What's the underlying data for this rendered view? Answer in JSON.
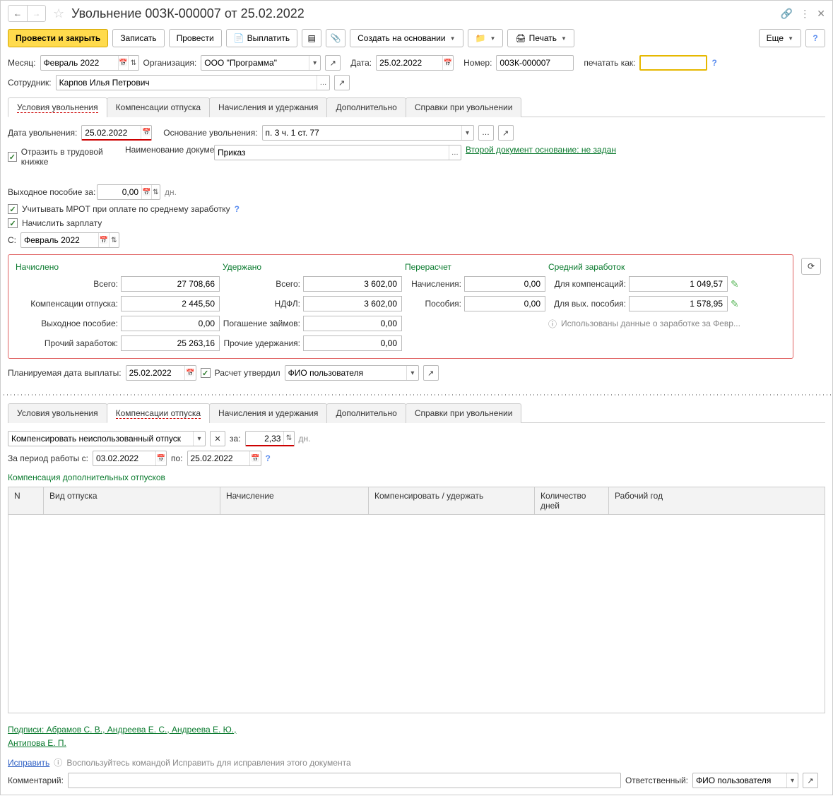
{
  "title": "Увольнение 00ЗК-000007 от 25.02.2022",
  "toolbar": {
    "post_close": "Провести и закрыть",
    "write": "Записать",
    "post": "Провести",
    "pay": "Выплатить",
    "create_based": "Создать на основании",
    "print": "Печать",
    "more": "Еще"
  },
  "header": {
    "month_label": "Месяц:",
    "month": "Февраль 2022",
    "org_label": "Организация:",
    "org": "ООО \"Программа\"",
    "date_label": "Дата:",
    "date": "25.02.2022",
    "number_label": "Номер:",
    "number": "00ЗК-000007",
    "print_as_label": "печатать как:",
    "print_as": "",
    "employee_label": "Сотрудник:",
    "employee": "Карпов Илья Петрович"
  },
  "tabs1": [
    "Условия увольнения",
    "Компенсации отпуска",
    "Начисления и удержания",
    "Дополнительно",
    "Справки при увольнении"
  ],
  "tab1": {
    "dismiss_date_label": "Дата увольнения:",
    "dismiss_date": "25.02.2022",
    "basis_label": "Основание увольнения:",
    "basis": "п. 3 ч. 1 ст. 77",
    "reflect_label": "Отразить в трудовой книжке",
    "docname_label": "Наименование документа:",
    "docname": "Приказ",
    "second_doc_link": "Второй документ основание: не задан",
    "severance_label": "Выходное пособие за:",
    "severance_val": "0,00",
    "days_suffix": "дн.",
    "mrot_label": "Учитывать МРОТ при оплате по среднему заработку",
    "accrue_salary_label": "Начислить зарплату",
    "from_label": "С:",
    "from_val": "Февраль 2022"
  },
  "summary": {
    "accrued_hdr": "Начислено",
    "withheld_hdr": "Удержано",
    "recalc_hdr": "Перерасчет",
    "avg_hdr": "Средний заработок",
    "total_label": "Всего:",
    "accrued_total": "27 708,66",
    "comp_label": "Компенсации отпуска:",
    "comp_val": "2 445,50",
    "sev_label": "Выходное пособие:",
    "sev_val": "0,00",
    "other_label": "Прочий заработок:",
    "other_val": "25 263,16",
    "withheld_total": "3 602,00",
    "ndfl_label": "НДФЛ:",
    "ndfl_val": "3 602,00",
    "loan_label": "Погашение займов:",
    "loan_val": "0,00",
    "other_withh_label": "Прочие удержания:",
    "other_withh_val": "0,00",
    "recalc_accr_label": "Начисления:",
    "recalc_accr_val": "0,00",
    "recalc_ben_label": "Пособия:",
    "recalc_ben_val": "0,00",
    "avg_comp_label": "Для компенсаций:",
    "avg_comp_val": "1 049,57",
    "avg_sev_label": "Для вых. пособия:",
    "avg_sev_val": "1 578,95",
    "info_text": "Использованы данные о заработке за Февр..."
  },
  "planned": {
    "date_label": "Планируемая дата выплаты:",
    "date_val": "25.02.2022",
    "approved_label": "Расчет утвердил",
    "approver": "ФИО пользователя"
  },
  "tabs2": [
    "Условия увольнения",
    "Компенсации отпуска",
    "Начисления и удержания",
    "Дополнительно",
    "Справки при увольнении"
  ],
  "tab2": {
    "comp_type": "Компенсировать неиспользованный отпуск",
    "for_label": "за:",
    "for_val": "2,33",
    "days_suffix": "дн.",
    "period_label": "За период работы с:",
    "period_from": "03.02.2022",
    "period_to_label": "по:",
    "period_to": "25.02.2022",
    "add_vac_label": "Компенсация дополнительных отпусков",
    "cols": {
      "n": "N",
      "type": "Вид отпуска",
      "accr": "Начисление",
      "comp": "Компенсировать / удержать",
      "days": "Количество дней",
      "year": "Рабочий год"
    }
  },
  "footer": {
    "sig_label": "Подписи: Абрамов С. В., Андреева Е. С., Андреева Е. Ю.,",
    "sig_line2": "Антипова Е. П.",
    "fix_link": "Исправить",
    "fix_hint": "Воспользуйтесь командой Исправить для исправления этого документа",
    "comment_label": "Комментарий:",
    "resp_label": "Ответственный:",
    "resp_val": "ФИО пользователя"
  }
}
